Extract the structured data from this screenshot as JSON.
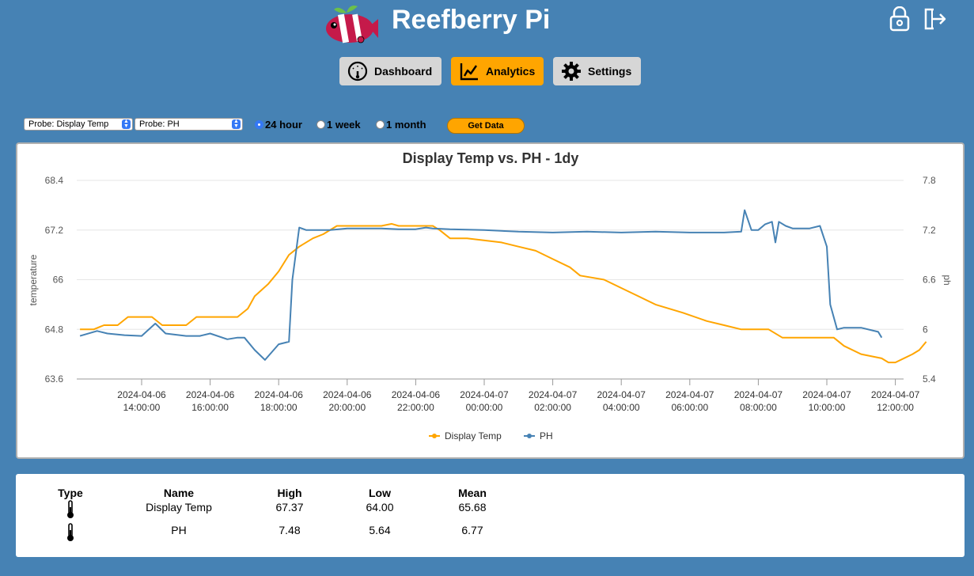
{
  "app": {
    "title": "Reefberry Pi"
  },
  "nav": {
    "dashboard": "Dashboard",
    "analytics": "Analytics",
    "settings": "Settings"
  },
  "controls": {
    "probe1": "Probe: Display Temp",
    "probe2": "Probe: PH",
    "ranges": [
      "24 hour",
      "1 week",
      "1 month"
    ],
    "selected_range": "24 hour",
    "get_data": "Get Data"
  },
  "colors": {
    "background": "#4682b4",
    "accent": "#ffa500",
    "temp": "#ffa500",
    "ph": "#4682b4"
  },
  "chart_data": {
    "type": "line",
    "title": "Display Temp vs. PH - 1dy",
    "ylabel": "temperature",
    "y2label": "ph",
    "ylim": [
      63.6,
      68.4
    ],
    "y2lim": [
      5.4,
      7.8
    ],
    "yticks": [
      "68.4",
      "67.2",
      "66",
      "64.8",
      "63.6"
    ],
    "y2ticks": [
      "7.8",
      "7.2",
      "6.6",
      "6",
      "5.4"
    ],
    "xticks": [
      [
        "2024-04-06",
        "14:00:00"
      ],
      [
        "2024-04-06",
        "16:00:00"
      ],
      [
        "2024-04-06",
        "18:00:00"
      ],
      [
        "2024-04-06",
        "20:00:00"
      ],
      [
        "2024-04-06",
        "22:00:00"
      ],
      [
        "2024-04-07",
        "00:00:00"
      ],
      [
        "2024-04-07",
        "02:00:00"
      ],
      [
        "2024-04-07",
        "04:00:00"
      ],
      [
        "2024-04-07",
        "06:00:00"
      ],
      [
        "2024-04-07",
        "08:00:00"
      ],
      [
        "2024-04-07",
        "10:00:00"
      ],
      [
        "2024-04-07",
        "12:00:00"
      ]
    ],
    "grid": true,
    "legend": "bottom",
    "series": [
      {
        "name": "Display Temp",
        "axis": "left",
        "x": [
          12.2,
          12.6,
          12.9,
          13.3,
          13.6,
          14.3,
          14.6,
          15.3,
          15.6,
          16.8,
          17.1,
          17.3,
          17.7,
          18.0,
          18.3,
          18.6,
          19.0,
          19.3,
          19.7,
          20.0,
          21.0,
          21.3,
          21.5,
          22.5,
          22.7,
          23.0,
          23.5,
          24.5,
          25.0,
          25.5,
          26.0,
          26.5,
          26.8,
          27.5,
          28.0,
          28.5,
          29.0,
          29.8,
          30.5,
          31.0,
          31.5,
          32.3,
          32.7,
          33.0,
          33.2,
          34.2,
          34.5,
          35.0,
          35.6,
          35.8,
          36.0,
          36.5,
          36.7,
          36.9
        ],
        "y": [
          64.8,
          64.8,
          64.9,
          64.9,
          65.1,
          65.1,
          64.9,
          64.9,
          65.1,
          65.1,
          65.3,
          65.6,
          65.9,
          66.2,
          66.6,
          66.8,
          67.0,
          67.1,
          67.3,
          67.3,
          67.3,
          67.35,
          67.3,
          67.3,
          67.2,
          67.0,
          67.0,
          66.9,
          66.8,
          66.7,
          66.5,
          66.3,
          66.1,
          66.0,
          65.8,
          65.6,
          65.4,
          65.2,
          65.0,
          64.9,
          64.8,
          64.8,
          64.6,
          64.6,
          64.6,
          64.6,
          64.4,
          64.2,
          64.1,
          64.0,
          64.0,
          64.2,
          64.3,
          64.5
        ]
      },
      {
        "name": "PH",
        "axis": "right",
        "x": [
          12.2,
          12.7,
          13.0,
          13.5,
          14.0,
          14.4,
          14.7,
          15.3,
          15.7,
          16.0,
          16.5,
          16.8,
          17.0,
          17.3,
          17.6,
          18.0,
          18.3,
          18.4,
          18.6,
          18.8,
          19.0,
          19.5,
          20.0,
          20.5,
          21.0,
          21.5,
          22.0,
          22.3,
          22.5,
          23.0,
          24.0,
          25.0,
          26.0,
          27.0,
          28.0,
          29.0,
          30.0,
          31.0,
          31.5,
          31.6,
          31.8,
          32.0,
          32.2,
          32.4,
          32.5,
          32.6,
          32.8,
          33.0,
          33.5,
          33.8,
          34.0,
          34.1,
          34.3,
          34.5,
          35.0,
          35.5,
          35.6
        ],
        "y": [
          5.92,
          5.98,
          5.95,
          5.93,
          5.92,
          6.07,
          5.95,
          5.92,
          5.92,
          5.95,
          5.88,
          5.9,
          5.9,
          5.75,
          5.63,
          5.82,
          5.85,
          6.6,
          7.23,
          7.2,
          7.2,
          7.2,
          7.22,
          7.22,
          7.22,
          7.21,
          7.21,
          7.23,
          7.22,
          7.21,
          7.2,
          7.18,
          7.17,
          7.18,
          7.17,
          7.18,
          7.17,
          7.17,
          7.18,
          7.44,
          7.2,
          7.2,
          7.27,
          7.3,
          7.05,
          7.3,
          7.25,
          7.22,
          7.22,
          7.25,
          7.0,
          6.3,
          6.0,
          6.02,
          6.02,
          5.97,
          5.9
        ]
      }
    ]
  },
  "stats": {
    "headers": {
      "type": "Type",
      "name": "Name",
      "high": "High",
      "low": "Low",
      "mean": "Mean"
    },
    "rows": [
      {
        "icon": "thermometer-icon",
        "name": "Display Temp",
        "high": "67.37",
        "low": "64.00",
        "mean": "65.68"
      },
      {
        "icon": "thermometer-icon",
        "name": "PH",
        "high": "7.48",
        "low": "5.64",
        "mean": "6.77"
      }
    ]
  }
}
